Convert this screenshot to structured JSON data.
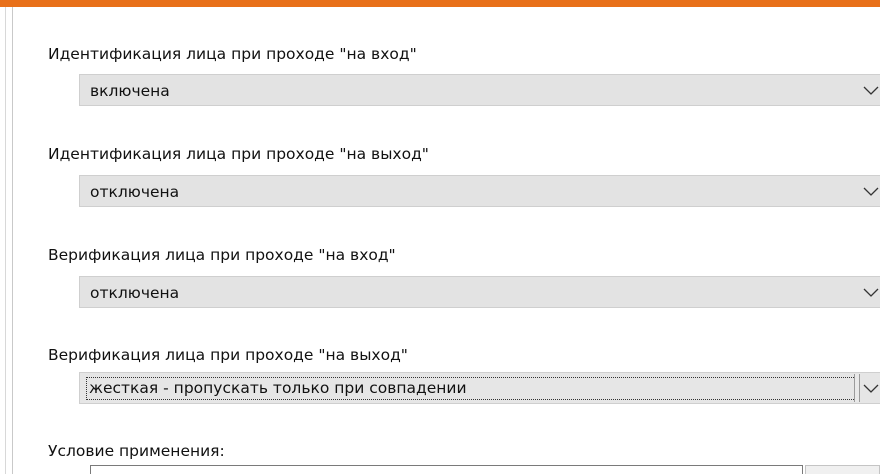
{
  "fields": [
    {
      "label": "Идентификация лица при проходе \"на вход\"",
      "value": "включена"
    },
    {
      "label": "Идентификация лица при проходе \"на выход\"",
      "value": "отключена"
    },
    {
      "label": "Верификация лица при проходе \"на вход\"",
      "value": "отключена"
    },
    {
      "label": "Верификация лица при проходе \"на выход\"",
      "value": "жесткая - пропускать только при совпадении"
    }
  ],
  "condition": {
    "label": "Условие применения:",
    "value": ""
  },
  "colors": {
    "accent": "#e8701a",
    "select_bg": "#e3e3e3"
  },
  "icons": {
    "dropdown": "chevron-down-icon"
  }
}
